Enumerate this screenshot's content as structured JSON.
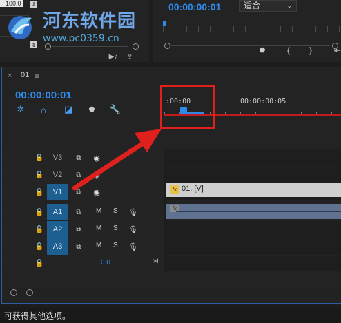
{
  "watermark": {
    "title": "河东软件园",
    "url": "www.pc0359.cn"
  },
  "source_panel": {
    "value_top": "100.0"
  },
  "program_monitor": {
    "timecode": "00:00:00:01",
    "fit_option": "适合"
  },
  "timeline": {
    "tab_close": "×",
    "sequence_name": "01",
    "menu_glyph": "≡",
    "timecode": "00:00:00:01",
    "ruler": {
      "start": ":00:00",
      "mark": "00:00:00:05"
    },
    "tracks": [
      {
        "name": "V3",
        "active": false
      },
      {
        "name": "V2",
        "active": false
      },
      {
        "name": "V1",
        "active": true
      },
      {
        "name": "A1",
        "active": true,
        "m": "M",
        "s": "S"
      },
      {
        "name": "A2",
        "active": true,
        "m": "M",
        "s": "S"
      },
      {
        "name": "A3",
        "active": true,
        "m": "M",
        "s": "S"
      }
    ],
    "master_volume": "0.0",
    "video_clip": {
      "fx": "fx",
      "label": "01. [V]"
    },
    "audio_clip": {
      "fx": "fx"
    }
  },
  "status_bar": {
    "text": "可获得其他选项。"
  },
  "colors": {
    "accent": "#2d8ceb",
    "annotation": "#e0201d"
  }
}
